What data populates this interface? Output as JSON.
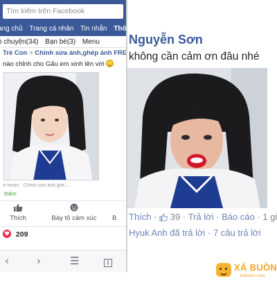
{
  "left": {
    "search_placeholder": "Tìm kiếm trên Facebook",
    "nav": [
      "ang chủ",
      "Trang cá nhân",
      "Tin nhắn",
      "Thôn"
    ],
    "subnav": [
      "ò chuyện(34)",
      "Bạn bè(3)",
      "Menu"
    ],
    "breadcrumb": [
      "Trẻ Con",
      "Chỉnh sửa ảnh,ghép ảnh FRE"
    ],
    "breadcrumb_sep": ">",
    "post_text": "nào chỉnh cho Gấu em xinh lên với",
    "meta": "ờ trước · Chỉnh sửa ảnh,ghé...",
    "more": "thêm",
    "actions": {
      "like": "Thích",
      "react": "Bày tỏ cảm xúc",
      "share": "B"
    },
    "reaction_count": "209",
    "browser_tabs": "1"
  },
  "right": {
    "commenter": "Nguyễn Sơn",
    "comment": "không cần cảm ơn đâu nhé",
    "like": "Thích",
    "like_count": "39",
    "reply": "Trả lời",
    "report": "Báo cáo",
    "time": "1 gi",
    "sep": "·",
    "replies_line": "Hyuk Anh đã trả lời · 7 câu trả lời"
  },
  "watermark": {
    "title": "XẢ BUỒN",
    "sub": "Xabuon.com"
  },
  "colors": {
    "facebook_blue": "#3b5998",
    "link_blue": "#6d84b4",
    "heart_red": "#f02849",
    "watermark_orange": "#f5a623"
  }
}
